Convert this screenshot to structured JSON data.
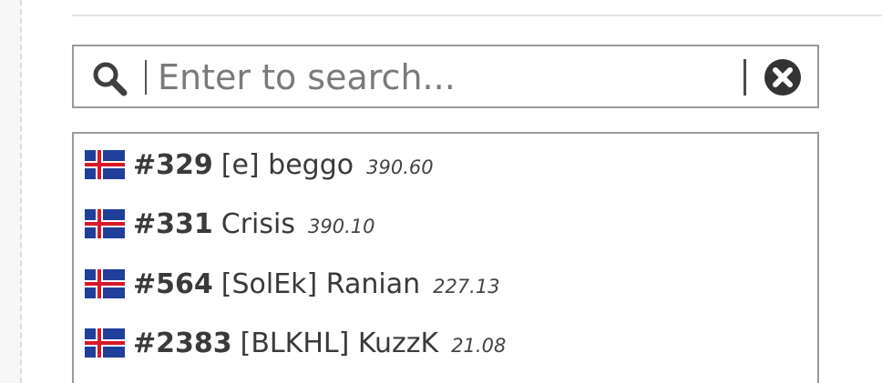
{
  "search": {
    "placeholder": "Enter to search..."
  },
  "icons": {
    "search": "magnifying-glass",
    "clear": "circle-x",
    "flag": "iceland-flag"
  },
  "colors": {
    "flag_blue": "#1f3f99",
    "flag_red": "#d7182a",
    "text": "#3a3a3a",
    "border": "#9a9a9a"
  },
  "results": [
    {
      "country": "Iceland",
      "rank": "#329",
      "name": "[e] beggo",
      "score": "390.60"
    },
    {
      "country": "Iceland",
      "rank": "#331",
      "name": "Crisis",
      "score": "390.10"
    },
    {
      "country": "Iceland",
      "rank": "#564",
      "name": "[SolEk] Ranian",
      "score": "227.13"
    },
    {
      "country": "Iceland",
      "rank": "#2383",
      "name": "[BLKHL] KuzzK",
      "score": "21.08"
    }
  ]
}
